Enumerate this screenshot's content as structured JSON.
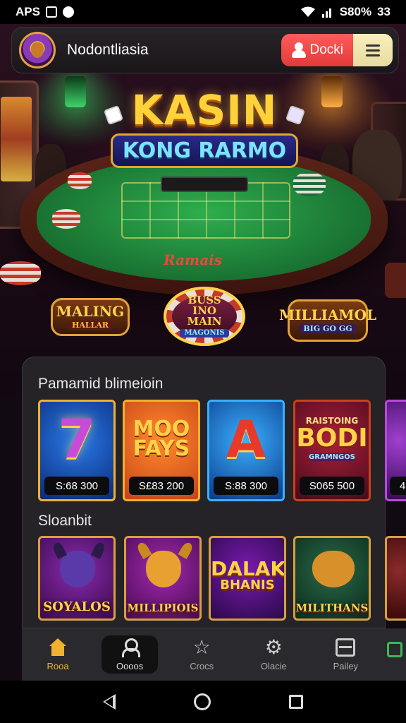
{
  "status_bar": {
    "left_text": "APS",
    "right_text": "S80%",
    "time": "33"
  },
  "header": {
    "app_name": "Nodontliasia",
    "login_label": "Docki",
    "icons": [
      "avatar-lion",
      "person-icon",
      "menu-icon"
    ]
  },
  "hero": {
    "logo_line1": "KASIN",
    "logo_line2": "KONG RARMO",
    "felt_text": "Ramais",
    "badge_left": {
      "title": "MALING",
      "sub": "HALLAR"
    },
    "badge_center": {
      "title": "BUSS INO MAIN",
      "sub": "MAGONIS"
    },
    "badge_right": {
      "title": "MILLIAMOL",
      "sub": "BIG GO GG"
    }
  },
  "panel": {
    "section1_title": "Pamamid blimeioin",
    "section2_title": "Sloanbit",
    "featured_games": [
      {
        "art": "7",
        "price": "S:68 300",
        "colors": {
          "bg1": "#2a7ae8",
          "bg2": "#0a2a7a",
          "border": "#f0b030"
        }
      },
      {
        "art": "MOO FAYS",
        "price": "S£83 200",
        "colors": {
          "bg1": "#ff8a2a",
          "bg2": "#c8421a",
          "border": "#f0b030"
        }
      },
      {
        "art": "A",
        "price": "S:88 300",
        "colors": {
          "bg1": "#3ab0ff",
          "bg2": "#0a3a8a",
          "border": "#3ab0ff"
        }
      },
      {
        "art_small": "RAISTOING",
        "art": "BODI",
        "art_small2": "GRAMNGOS",
        "price": "S065 500",
        "colors": {
          "bg1": "#a8203a",
          "bg2": "#4a0a1a",
          "border": "#c8421a"
        }
      },
      {
        "art": "",
        "price": "4",
        "colors": {
          "bg1": "#a040d0",
          "bg2": "#3a0a5a",
          "border": "#b84ad8"
        }
      }
    ],
    "slot_games": [
      {
        "label": "SOYALOS",
        "colors": {
          "bg1": "#8a2ab0",
          "bg2": "#3a0a4a",
          "head": "#5a3aa8"
        }
      },
      {
        "label": "MILLIPIOIS",
        "colors": {
          "bg1": "#a02ab0",
          "bg2": "#4a0a50",
          "head": "#e8a030"
        }
      },
      {
        "label_top": "DALAK",
        "label_bottom": "BHANIS",
        "colors": {
          "bg1": "#7a1ab0",
          "bg2": "#2a0a4a"
        }
      },
      {
        "label": "MILITHANS",
        "colors": {
          "bg1": "#2a6a4a",
          "bg2": "#0a2a1a",
          "head": "#d8902a"
        }
      },
      {
        "label": "",
        "colors": {
          "bg1": "#8a2a2a",
          "bg2": "#3a0a0a"
        }
      }
    ]
  },
  "bottom_nav": {
    "items": [
      {
        "label": "Rooa",
        "icon": "home-icon"
      },
      {
        "label": "Oooos",
        "icon": "user-icon"
      },
      {
        "label": "Crocs",
        "icon": "star-icon"
      },
      {
        "label": "Olacie",
        "icon": "gear-icon"
      },
      {
        "label": "Pailey",
        "icon": "table-icon"
      }
    ]
  },
  "colors": {
    "accent_gold": "#f0b030",
    "login_red": "#e23a3a",
    "menu_cream": "#f8efbc",
    "panel_bg": "#262428"
  }
}
